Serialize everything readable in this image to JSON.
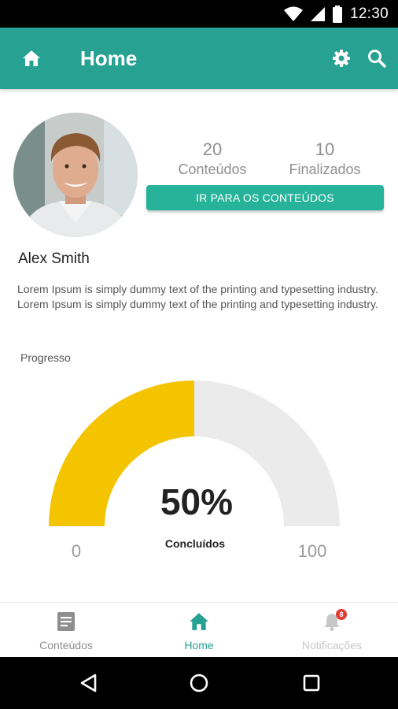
{
  "status_bar": {
    "time": "12:30",
    "icons": [
      "wifi-icon",
      "signal-icon",
      "battery-icon"
    ]
  },
  "app_bar": {
    "title": "Home",
    "icons": [
      "home-icon",
      "settings-icon",
      "search-icon"
    ]
  },
  "profile": {
    "name": "Alex Smith",
    "bio": "Lorem Ipsum is simply dummy text of the printing and typesetting industry. Lorem Ipsum is simply dummy text of the printing and typesetting industry.",
    "stats": {
      "conteudos": {
        "value": "20",
        "label": "Conteúdos"
      },
      "finalizados": {
        "value": "10",
        "label": "Finalizados"
      }
    },
    "cta_label": "IR PARA OS CONTEÚDOS"
  },
  "progress": {
    "label": "Progresso",
    "value_text": "50%",
    "fraction": 0.5,
    "caption": "Concluídos",
    "min_label": "0",
    "max_label": "100"
  },
  "bottom_nav": {
    "items": [
      {
        "label": "Conteúdos",
        "icon": "document-icon",
        "active": false
      },
      {
        "label": "Home",
        "icon": "home-icon",
        "active": true
      },
      {
        "label": "Notificações",
        "icon": "bell-icon",
        "active": false,
        "badge": "8"
      }
    ]
  },
  "system_nav": {
    "icons": [
      "back-icon",
      "home-circle-icon",
      "recents-icon"
    ]
  },
  "colors": {
    "primary": "#26a192",
    "button": "#26b39a",
    "gauge_fill": "#f5c400",
    "gauge_track": "#ebebeb",
    "badge": "#e53935"
  }
}
